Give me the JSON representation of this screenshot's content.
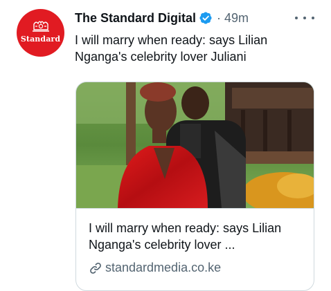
{
  "tweet": {
    "display_name": "The Standard Digital",
    "separator": "·",
    "time": "49m",
    "text": "I will marry when ready: says Lilian Nganga's celebrity lover Juliani",
    "avatar_text": "Standard"
  },
  "card": {
    "title": "I will marry when ready: says Lilian Nganga's celebrity lover ...",
    "domain": "standardmedia.co.ke"
  },
  "colors": {
    "brand_red": "#e11b22",
    "verified_blue": "#1d9bf0",
    "text_primary": "#0f1419",
    "text_secondary": "#536471",
    "border": "#cfd9de"
  },
  "icons": [
    "verified-badge-icon",
    "more-options-icon",
    "link-icon"
  ]
}
